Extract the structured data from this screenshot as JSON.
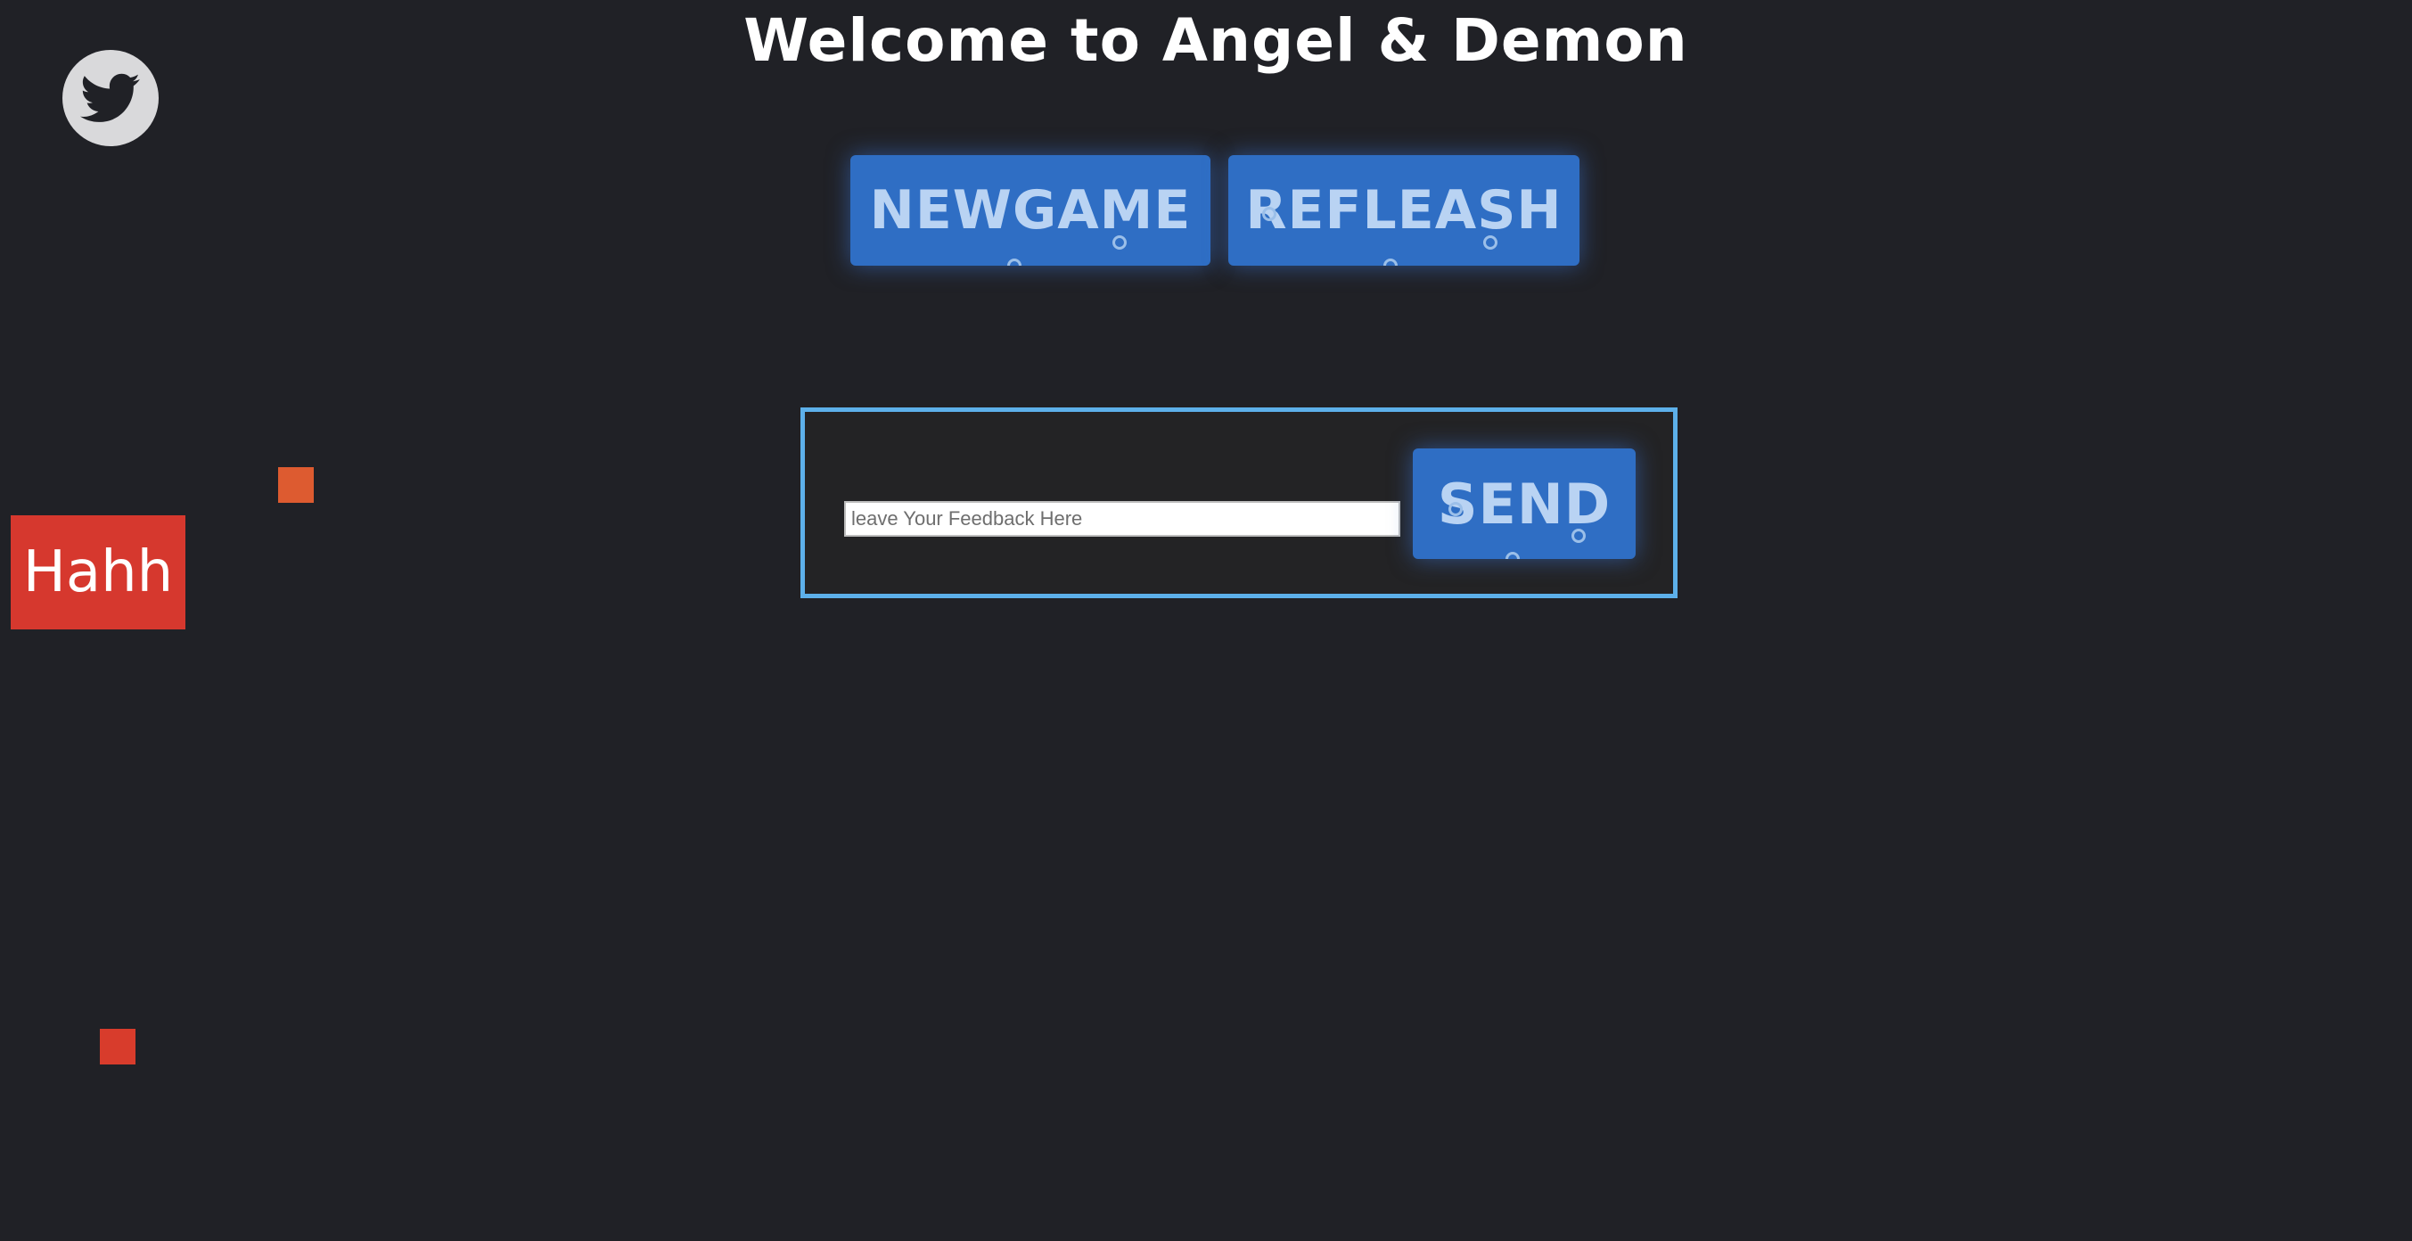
{
  "header": {
    "title": "Welcome to Angel & Demon"
  },
  "social": {
    "twitter_icon": "twitter-bird-icon"
  },
  "controls": {
    "newgame_label": "NEWGAME",
    "refleash_label": "REFLEASH"
  },
  "feedback": {
    "placeholder": "leave Your Feedback Here",
    "value": "",
    "send_label": "SEND"
  },
  "game": {
    "hahh_label": "Hahh"
  },
  "colors": {
    "background": "#202126",
    "button_blue": "#2f6ec4",
    "button_text": "#b9d3f3",
    "panel_border": "#5db0ea",
    "hahh_red": "#d6382e",
    "square_orange": "#dd5b30",
    "square_red": "#d83c2c"
  }
}
